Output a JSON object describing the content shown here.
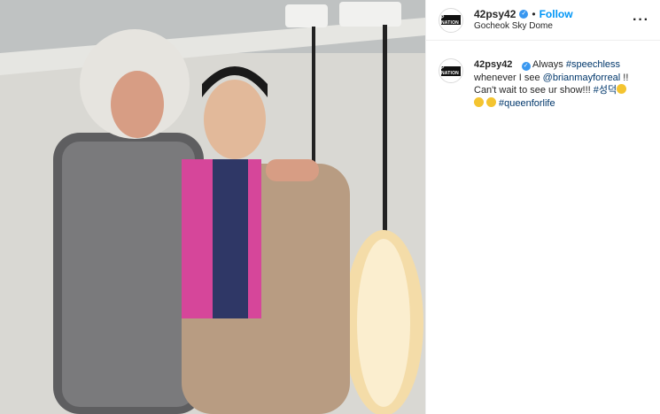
{
  "photo": {
    "description_icon": "photo-image"
  },
  "header": {
    "username": "42psy42",
    "verified_icon": "verified-badge-icon",
    "separator": "•",
    "follow_label": "Follow",
    "location": "Gocheok Sky Dome",
    "more_label": "···",
    "avatar_text": "P NATION"
  },
  "caption": {
    "username": "42psy42",
    "text_1": "Always ",
    "tag_speechless": "#speechless",
    "text_2": "whenever I see ",
    "tag_brian": "@brianmayforreal",
    "text_3": " !!",
    "text_4": "Can't wait to see ur show!!! ",
    "tag_korean": "#성덕",
    "tag_queen": "#queenforlife"
  },
  "colors": {
    "accent": "#0095f6",
    "link": "#00376b",
    "verified": "#3897f0"
  }
}
